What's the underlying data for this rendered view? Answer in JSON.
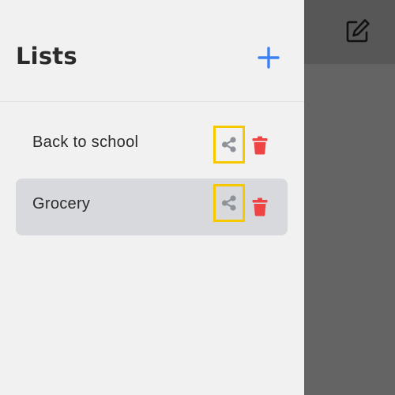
{
  "sidebar": {
    "title": "Lists",
    "items": [
      {
        "label": "Back to school",
        "active": false
      },
      {
        "label": "Grocery",
        "active": true
      }
    ]
  },
  "icons": {
    "add": "plus-icon",
    "share": "share-icon",
    "delete": "trash-icon",
    "edit": "edit-icon"
  },
  "colors": {
    "accent": "#3b82f6",
    "danger": "#ef4444",
    "share_icon": "#8e9299",
    "highlight_border": "#f6c800",
    "active_row": "#d7d9dd",
    "overlay": "#646464"
  }
}
